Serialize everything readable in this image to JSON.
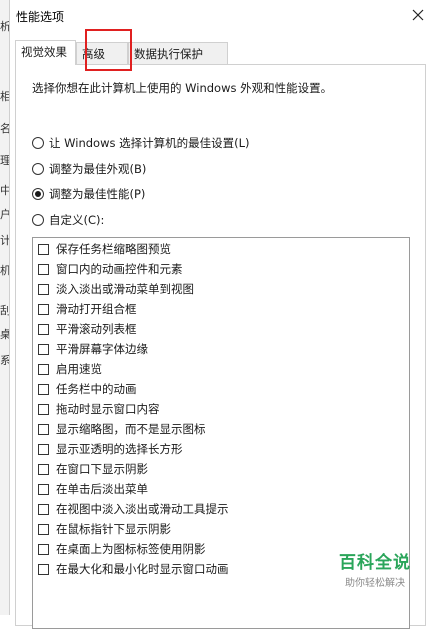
{
  "window": {
    "title": "性能选项"
  },
  "background_fragments": [
    "析",
    "相",
    "名",
    "理",
    "中",
    "户",
    "计",
    "机",
    "刮",
    "桌",
    "系"
  ],
  "tabs": [
    {
      "label": "视觉效果"
    },
    {
      "label": "高级"
    },
    {
      "label": "数据执行保护"
    }
  ],
  "panel": {
    "description": "选择你想在此计算机上使用的 Windows 外观和性能设置。",
    "options": [
      {
        "label": "让 Windows 选择计算机的最佳设置(L)",
        "checked": false
      },
      {
        "label": "调整为最佳外观(B)",
        "checked": false
      },
      {
        "label": "调整为最佳性能(P)",
        "checked": true
      },
      {
        "label": "自定义(C):",
        "checked": false
      }
    ],
    "effects": [
      "保存任务栏缩略图预览",
      "窗口内的动画控件和元素",
      "淡入淡出或滑动菜单到视图",
      "滑动打开组合框",
      "平滑滚动列表框",
      "平滑屏幕字体边缘",
      "启用速览",
      "任务栏中的动画",
      "拖动时显示窗口内容",
      "显示缩略图，而不是显示图标",
      "显示亚透明的选择长方形",
      "在窗口下显示阴影",
      "在单击后淡出菜单",
      "在视图中淡入淡出或滑动工具提示",
      "在鼠标指针下显示阴影",
      "在桌面上为图标标签使用阴影",
      "在最大化和最小化时显示窗口动画"
    ]
  },
  "watermark": {
    "main": "百科全说",
    "sub": "助你轻松解决"
  },
  "colors": {
    "highlight": "#e02020",
    "watermark": "#2aa55a"
  }
}
